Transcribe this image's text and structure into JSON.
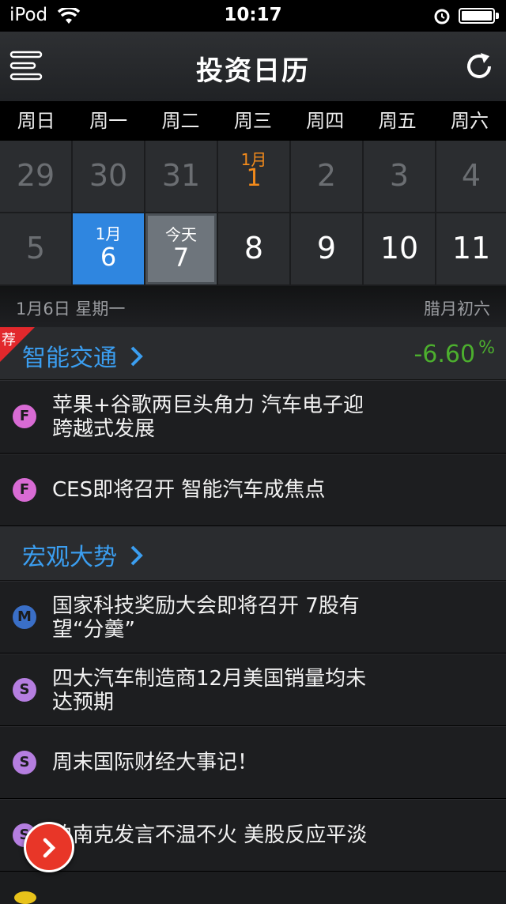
{
  "status": {
    "carrier": "iPod",
    "time": "10:17"
  },
  "nav": {
    "title": "投资日历",
    "menu_icon": "menu-icon",
    "refresh_icon": "refresh-icon"
  },
  "weekdays": [
    "周日",
    "周一",
    "周二",
    "周三",
    "周四",
    "周五",
    "周六"
  ],
  "week1": [
    {
      "num": "29"
    },
    {
      "num": "30"
    },
    {
      "num": "31"
    },
    {
      "num": "1",
      "sub": "1月"
    },
    {
      "num": "2"
    },
    {
      "num": "3"
    },
    {
      "num": "4"
    }
  ],
  "week2": [
    {
      "num": "5"
    },
    {
      "num": "6",
      "sub": "1月"
    },
    {
      "num": "7",
      "sub": "今天"
    },
    {
      "num": "8"
    },
    {
      "num": "9"
    },
    {
      "num": "10"
    },
    {
      "num": "11"
    }
  ],
  "date_bar": {
    "date": "1月6日 星期一",
    "lunar": "腊月初六"
  },
  "sections": [
    {
      "ribbon": "荐",
      "name": "智能交通",
      "change": "-6.60",
      "pct_sign": "%"
    },
    {
      "name": "宏观大势"
    }
  ],
  "items": [
    {
      "badge": "F",
      "color": "#d86bd4",
      "line1": "苹果+谷歌两巨头角力 汽车电子迎",
      "line2": "跨越式发展"
    },
    {
      "badge": "F",
      "color": "#d86bd4",
      "line1": "CES即将召开 智能汽车成焦点",
      "line2": ""
    },
    {
      "badge": "M",
      "color": "#3a6fc7",
      "line1": "国家科技奖励大会即将召开 7股有",
      "line2": "望“分羹”"
    },
    {
      "badge": "S",
      "color": "#b57ee0",
      "line1": "四大汽车制造商12月美国销量均未",
      "line2": "达预期"
    },
    {
      "badge": "S",
      "color": "#b57ee0",
      "line1": "周末国际财经大事记！",
      "line2": ""
    },
    {
      "badge": "S",
      "color": "#b57ee0",
      "line1": "伯南克发言不温不火  美股反应平淡",
      "line2": ""
    }
  ],
  "colors": {
    "accent": "#3b9ef0",
    "selected": "#2f86e0",
    "up_down": "#4caf2e",
    "highlight": "#f28a1b",
    "fab": "#e83628"
  }
}
